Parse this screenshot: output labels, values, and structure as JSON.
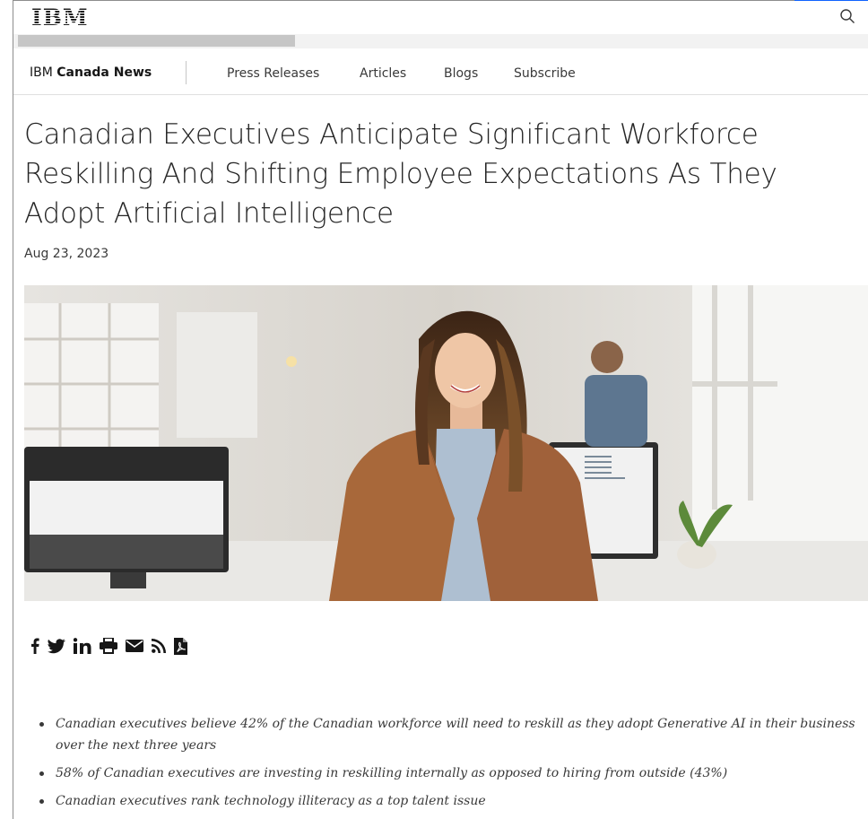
{
  "masthead": {
    "logo": "IBM",
    "search_icon": "search-icon"
  },
  "progress": {
    "value": 0.33
  },
  "subnav": {
    "brand_prefix": "IBM",
    "brand_bold": "Canada News",
    "links": [
      "Press Releases",
      "Articles",
      "Blogs",
      "Subscribe"
    ]
  },
  "article": {
    "headline": "Canadian Executives Anticipate Significant Workforce Reskilling And Shifting Employee Expectations As They Adopt Artificial Intelligence",
    "date": "Aug 23, 2023",
    "hero_image": "photo-smiling-woman-in-brown-blazer-in-office",
    "share_icons": [
      "facebook-icon",
      "twitter-icon",
      "linkedin-icon",
      "print-icon",
      "email-icon",
      "rss-icon",
      "pdf-icon"
    ],
    "bullets": [
      "Canadian executives believe 42% of the Canadian workforce will need to reskill as they adopt Generative AI in their business over the next three years",
      "58% of Canadian executives are investing in reskilling internally as opposed to hiring from outside (43%)",
      "Canadian executives rank technology illiteracy as a top talent issue"
    ]
  },
  "colors": {
    "accent": "#0f62fe",
    "text": "#161616",
    "blazer": "#a8683a"
  }
}
